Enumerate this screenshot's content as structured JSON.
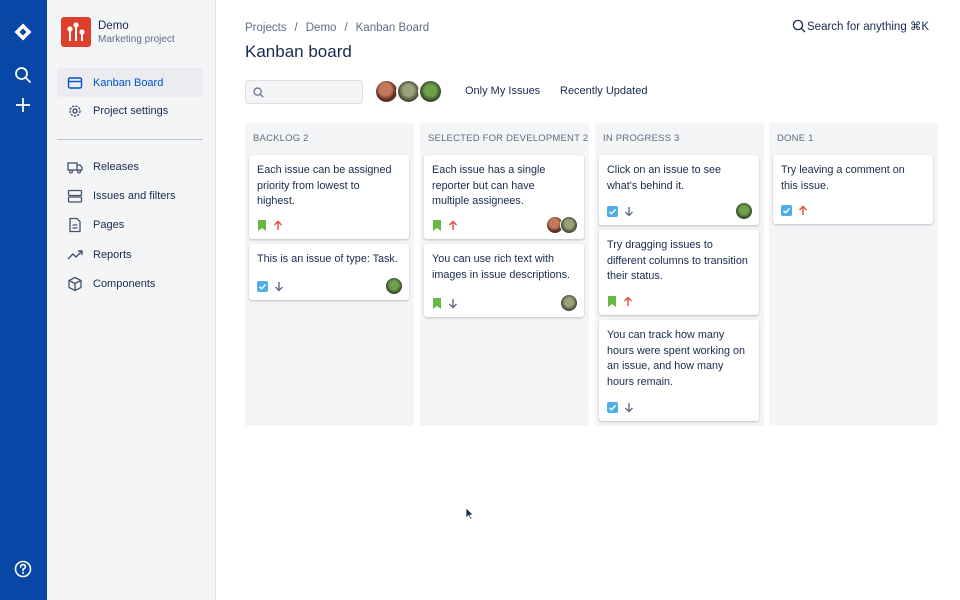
{
  "project": {
    "name": "Demo",
    "subtitle": "Marketing project"
  },
  "sidebar": {
    "items": [
      {
        "label": "Kanban Board",
        "icon": "board-icon",
        "active": true
      },
      {
        "label": "Project settings",
        "icon": "gear-icon"
      },
      {
        "label": "Releases",
        "icon": "truck-icon"
      },
      {
        "label": "Issues and filters",
        "icon": "stack-icon"
      },
      {
        "label": "Pages",
        "icon": "page-icon"
      },
      {
        "label": "Reports",
        "icon": "trend-icon"
      },
      {
        "label": "Components",
        "icon": "box-icon"
      }
    ]
  },
  "breadcrumb": [
    "Projects",
    "/",
    "Demo",
    "/",
    "Kanban Board"
  ],
  "page_title": "Kanban board",
  "global_search": {
    "label": "Search for anything ⌘K"
  },
  "filters": {
    "search_placeholder": "",
    "only_my": "Only My Issues",
    "recent": "Recently Updated"
  },
  "colors": {
    "rail": "#0747a6",
    "accent": "#0052cc",
    "story": "#65ba43",
    "task": "#4fade6",
    "high": "#e5493a",
    "low": "#5e6c84"
  },
  "lanes": [
    {
      "title": "BACKLOG 2",
      "cards": [
        {
          "text": "Each issue can be assigned priority from lowest to highest.",
          "type": "story",
          "priority": "high",
          "avatars": 0
        },
        {
          "text": "This is an issue of type: Task.",
          "type": "task",
          "priority": "low",
          "avatars": 1
        }
      ]
    },
    {
      "title": "SELECTED FOR DEVELOPMENT 2",
      "cards": [
        {
          "text": "Each issue has a single reporter but can have multiple assignees.",
          "type": "story",
          "priority": "high",
          "avatars": 2
        },
        {
          "text": "You can use rich text with images in issue descriptions.",
          "type": "story",
          "priority": "low",
          "avatars": 1
        }
      ]
    },
    {
      "title": "IN PROGRESS 3",
      "cards": [
        {
          "text": "Click on an issue to see what's behind it.",
          "type": "task",
          "priority": "low",
          "avatars": 1
        },
        {
          "text": "Try dragging issues to different columns to transition their status.",
          "type": "story",
          "priority": "high",
          "avatars": 0
        },
        {
          "text": "You can track how many hours were spent working on an issue, and how many hours remain.",
          "type": "task",
          "priority": "low",
          "avatars": 0
        }
      ]
    },
    {
      "title": "DONE 1",
      "cards": [
        {
          "text": "Try leaving a comment on this issue.",
          "type": "task",
          "priority": "high",
          "avatars": 0
        }
      ]
    }
  ]
}
